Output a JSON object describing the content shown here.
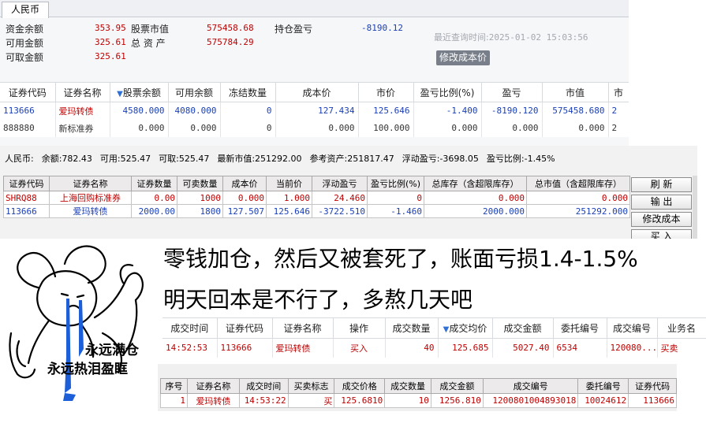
{
  "panel1": {
    "tab": "人民币",
    "summary": {
      "cash_label": "资金余额",
      "cash": "353.95",
      "available_label": "可用金额",
      "available": "325.61",
      "withdrawable_label": "可取金额",
      "withdrawable": "325.61",
      "stock_mv_label": "股票市值",
      "stock_mv": "575458.68",
      "total_assets_label": "总 资 产",
      "total_assets": "575784.29",
      "pnl_label": "持仓盈亏",
      "pnl": "-8190.12",
      "last_query_label": "最近查询时间:",
      "last_query_time": "2025-01-02 15:03:56",
      "modify_cost_button": "修改成本价"
    },
    "table": {
      "headers": [
        "证券代码",
        "证券名称",
        "股票余额",
        "可用余额",
        "冻结数量",
        "成本价",
        "市价",
        "盈亏比例(%)",
        "盈亏",
        "市值",
        "市"
      ],
      "rows": [
        [
          "113666",
          "爱玛转债",
          "4580.000",
          "4080.000",
          "0",
          "127.434",
          "125.646",
          "-1.400",
          "-8190.120",
          "575458.680",
          "2"
        ],
        [
          "888880",
          "新标准券",
          "0.000",
          "0.000",
          "0",
          "0.000",
          "100.000",
          "0.000",
          "0.000",
          "0.000",
          "2"
        ]
      ]
    }
  },
  "panel2": {
    "info": {
      "currency": "人民币:",
      "balance": "余额:782.43",
      "available": "可用:525.47",
      "withdrawable": "可取:525.47",
      "latest_mv": "最新市值:251292.00",
      "ref_assets": "参考资产:251817.47",
      "float_pnl": "浮动盈亏:-3698.05",
      "pnl_ratio": "盈亏比例:-1.45%"
    },
    "table": {
      "headers": [
        "证券代码",
        "证券名称",
        "证券数量",
        "可卖数量",
        "成本价",
        "当前价",
        "浮动盈亏",
        "盈亏比例(%)",
        "总库存（含超限库存）",
        "总市值（含超限库存）"
      ],
      "rows": [
        [
          "SHRQ88",
          "上海回购标准券",
          "0.00",
          "1000",
          "0.000",
          "1.000",
          "24.460",
          "0",
          "0.000",
          "0.000"
        ],
        [
          "113666",
          "爱玛转债",
          "2000.00",
          "1800",
          "127.507",
          "125.646",
          "-3722.510",
          "-1.460",
          "2000.000",
          "251292.000"
        ]
      ]
    },
    "buttons": [
      "刷 新",
      "输 出",
      "修改成本",
      "买 入"
    ]
  },
  "caption": {
    "line1": "零钱加仓，然后又被套死了，账面亏损1.4-1.5%",
    "line2": "明天回本是不行了，多熬几天吧"
  },
  "meme": {
    "line1": "永远满仓",
    "line2": "永远热泪盈眶"
  },
  "panel3": {
    "headers": [
      "成交时间",
      "证券代码",
      "证券名称",
      "操作",
      "成交数量",
      "成交均价",
      "成交金额",
      "委托编号",
      "成交编号",
      "业务名"
    ],
    "rows": [
      [
        "14:52:53",
        "113666",
        "爱玛转债",
        "买入",
        "40",
        "125.685",
        "5027.40",
        "6534",
        "120080...",
        "买卖"
      ]
    ]
  },
  "panel4": {
    "headers": [
      "序号",
      "证券名称",
      "成交时间",
      "买卖标志",
      "成交价格",
      "成交数量",
      "成交金额",
      "成交编号",
      "委托编号",
      "证券代码"
    ],
    "rows": [
      [
        "1",
        "爱玛转债",
        "14:53:22",
        "买",
        "125.6810",
        "10",
        "1256.810",
        "1200801004893018",
        "10024612",
        "113666"
      ]
    ]
  },
  "colors": {
    "red": "#c00000",
    "blue": "#1a3fb8",
    "sort_icon": "#2f6fd6"
  },
  "icons": [
    "sort-down-icon",
    "crying-mouse-meme-image"
  ]
}
